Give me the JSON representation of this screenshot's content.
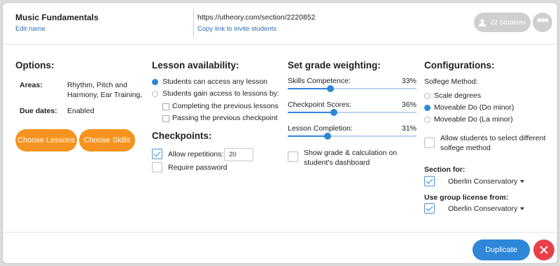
{
  "header": {
    "title": "Music Fundamentals",
    "edit_label": "Edit name",
    "url": "https://utheory.com/section/2220852",
    "copy_label": "Copy link to invite students",
    "students_label": "22 Students",
    "more_label": "•••"
  },
  "options": {
    "heading": "Options:",
    "areas_label": "Areas:",
    "areas_line1": "Rhythm, Pitch and",
    "areas_line2": "Harmony, Ear Training,",
    "due_label": "Due dates:",
    "due_value": "Enabled",
    "choose_lessons": "Choose Lessons",
    "choose_skills": "Choose Skills"
  },
  "availability": {
    "heading": "Lesson availability:",
    "opt_any": "Students can access any lesson",
    "opt_gain": "Students gain access to lessons by:",
    "sub_completing": "Completing the previous lessons",
    "sub_passing": "Passing the previous checkpoint",
    "selected": "opt_any"
  },
  "checkpoints": {
    "heading": "Checkpoints:",
    "allow_label": "Allow repetitions:",
    "allow_checked": true,
    "repetitions_value": "20",
    "password_label": "Require password",
    "password_checked": false
  },
  "grading": {
    "heading": "Set grade weighting:",
    "items": [
      {
        "label": "Skills Competence:",
        "value": 33,
        "display": "33%"
      },
      {
        "label": "Checkpoint Scores:",
        "value": 36,
        "display": "36%"
      },
      {
        "label": "Lesson Completion:",
        "value": 31,
        "display": "31%"
      }
    ],
    "dashboard_line1": "Show grade & calculation on",
    "dashboard_line2": "student's dashboard",
    "dashboard_checked": false
  },
  "config": {
    "heading": "Configurations:",
    "solfege_label": "Solfege Method:",
    "solfege_options": [
      "Scale degrees",
      "Moveable Do (Do minor)",
      "Moveable Do (La minor)"
    ],
    "solfege_selected": "Moveable Do (Do minor)",
    "allow_diff_line1": "Allow students to select different",
    "allow_diff_line2": "solfege method",
    "section_for_label": "Section for:",
    "section_for_value": "Oberlin Conservatory",
    "license_label": "Use group license from:",
    "license_value": "Oberlin Conservatory"
  },
  "footer": {
    "duplicate_label": "Duplicate"
  },
  "colors": {
    "accent_blue": "#2e87d8",
    "orange": "#f7931e",
    "close_red": "#e8404a",
    "link_blue": "#2e6fb2"
  }
}
